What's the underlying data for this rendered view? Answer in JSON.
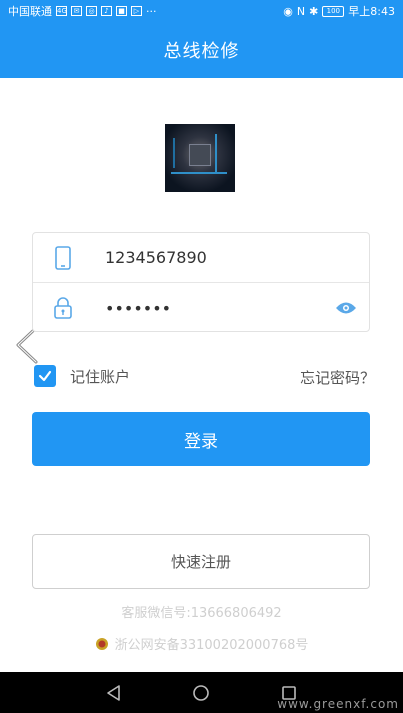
{
  "status_bar": {
    "carrier": "中国联通",
    "time": "早上8:43",
    "battery": "100",
    "signal_icons": [
      "network-icon",
      "message-icon",
      "app-icon",
      "tiktok-icon",
      "news-icon",
      "video-icon",
      "more-icon"
    ],
    "right_icons": [
      "eye-icon",
      "nfc-icon",
      "bluetooth-icon",
      "battery-icon"
    ]
  },
  "app_bar": {
    "title": "总线检修"
  },
  "login": {
    "account": {
      "value": "1234567890",
      "icon": "phone-icon"
    },
    "password": {
      "value": "•••••••",
      "icon": "lock-icon",
      "toggle_icon": "eye-icon"
    },
    "remember_label": "记住账户",
    "remember_checked": true,
    "forgot_label": "忘记密码？",
    "login_label": "登录",
    "register_label": "快速注册"
  },
  "footer": {
    "wechat": "客服微信号:13666806492",
    "record": "浙公网安备33100202000768号",
    "record_icon": "police-badge-icon"
  },
  "watermark": "www.greenxf.com",
  "colors": {
    "primary": "#2196f3",
    "background": "#ffffff"
  }
}
